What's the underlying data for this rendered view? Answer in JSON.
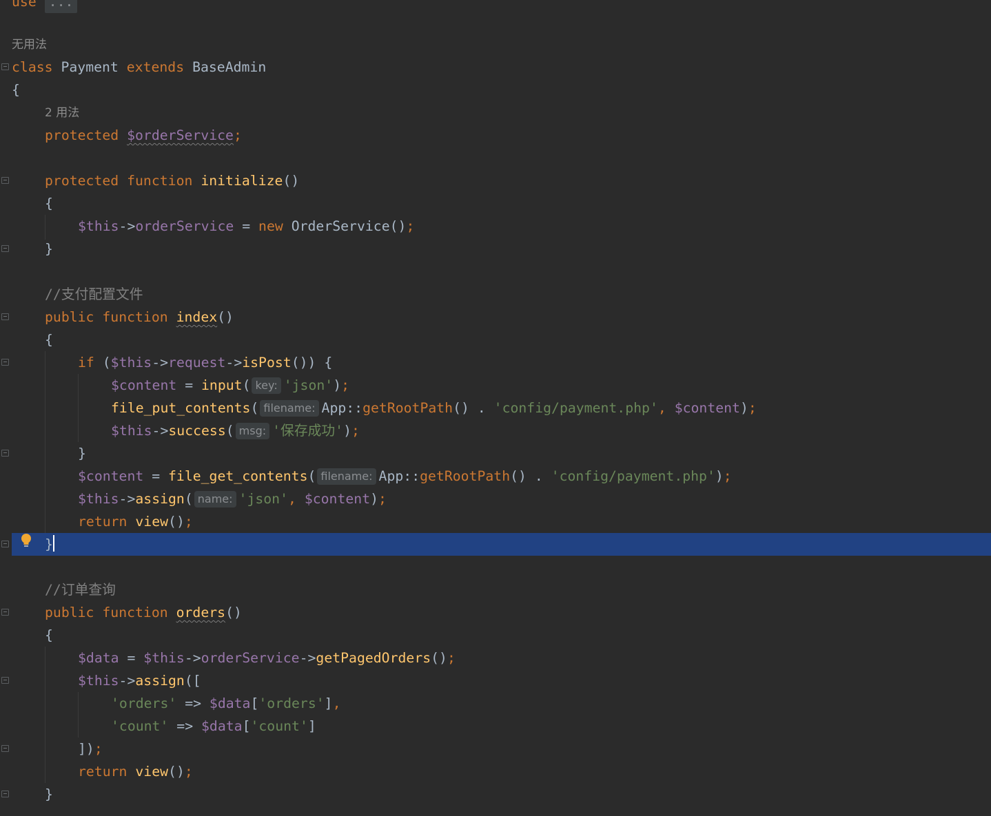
{
  "editor": {
    "top_line": {
      "kw": "use",
      "ellipsis": "..."
    },
    "class_usage": "无用法",
    "class_decl": {
      "kw_class": "class",
      "name": "Payment",
      "kw_extends": "extends",
      "parent": "BaseAdmin"
    },
    "open_brace": "{",
    "prop_usage": "2 用法",
    "prop_decl": {
      "kw": "protected",
      "var": "$orderService",
      "semi": ";"
    },
    "init_decl": {
      "kw1": "protected",
      "kw2": "function",
      "name": "initialize",
      "parens": "()"
    },
    "init_open": "{",
    "init_body": {
      "this": "$this",
      "arrow": "->",
      "prop": "orderService",
      "eq": " = ",
      "kw_new": "new",
      "cls": "OrderService",
      "call": "()",
      "semi": ";"
    },
    "init_close": "}",
    "comment_index": "//支付配置文件",
    "index_decl": {
      "kw1": "public",
      "kw2": "function",
      "name": "index",
      "parens": "()"
    },
    "index_open": "{",
    "if_line": {
      "kw": "if",
      "p1": " (",
      "this": "$this",
      "arrow1": "->",
      "prop": "request",
      "arrow2": "->",
      "fn": "isPost",
      "rest": "()) {"
    },
    "content_input": {
      "var": "$content",
      "eq": " = ",
      "fn": "input",
      "open": "(",
      "hint": "key:",
      "str": "'json'",
      "close": ")",
      "semi": ";"
    },
    "file_put": {
      "fn": "file_put_contents",
      "open": "(",
      "hint": "filename:",
      "cls": "App",
      "dc": "::",
      "fn2": "getRootPath",
      "call": "()",
      "dot": " . ",
      "str": "'config/payment.php'",
      "comma": ", ",
      "var": "$content",
      "close": ")",
      "semi": ";"
    },
    "success_line": {
      "this": "$this",
      "arrow": "->",
      "fn": "success",
      "open": "(",
      "hint": "msg:",
      "str": "'保存成功'",
      "close": ")",
      "semi": ";"
    },
    "if_close": "}",
    "file_get": {
      "var": "$content",
      "eq": " = ",
      "fn": "file_get_contents",
      "open": "(",
      "hint": "filename:",
      "cls": "App",
      "dc": "::",
      "fn2": "getRootPath",
      "call": "()",
      "dot": " . ",
      "str": "'config/payment.php'",
      "close": ")",
      "semi": ";"
    },
    "assign_line": {
      "this": "$this",
      "arrow": "->",
      "fn": "assign",
      "open": "(",
      "hint": "name:",
      "str": "'json'",
      "comma": ", ",
      "var": "$content",
      "close": ")",
      "semi": ";"
    },
    "return_line": {
      "kw": "return",
      "fn": "view",
      "call": "()",
      "semi": ";"
    },
    "index_close": "}",
    "comment_orders": "//订单查询",
    "orders_decl": {
      "kw1": "public",
      "kw2": "function",
      "name": "orders",
      "parens": "()"
    },
    "orders_open": "{",
    "data_line": {
      "var": "$data",
      "eq": " = ",
      "this": "$this",
      "arrow1": "->",
      "prop": "orderService",
      "arrow2": "->",
      "fn": "getPagedOrders",
      "call": "()",
      "semi": ";"
    },
    "assign2_line": {
      "this": "$this",
      "arrow": "->",
      "fn": "assign",
      "open": "(["
    },
    "orders_item": {
      "str": "'orders'",
      "arrow": " => ",
      "var": "$data",
      "ob": "[",
      "key": "'orders'",
      "cb": "]",
      "comma": ","
    },
    "count_item": {
      "str": "'count'",
      "arrow": " => ",
      "var": "$data",
      "ob": "[",
      "key": "'count'",
      "cb": "]"
    },
    "assign2_close": {
      "text": "])",
      "semi": ";"
    },
    "return2_line": {
      "kw": "return",
      "fn": "view",
      "call": "()",
      "semi": ";"
    },
    "orders_close": "}"
  },
  "colors": {
    "background": "#2b2b2b",
    "keyword": "#cc7832",
    "variable": "#9876aa",
    "function": "#ffc66d",
    "string": "#6a8759",
    "comment": "#808080",
    "text": "#a9b7c6",
    "current_line": "#214283"
  },
  "icons": {
    "bulb": "lightbulb-icon",
    "fold": "fold-marker-icon"
  }
}
